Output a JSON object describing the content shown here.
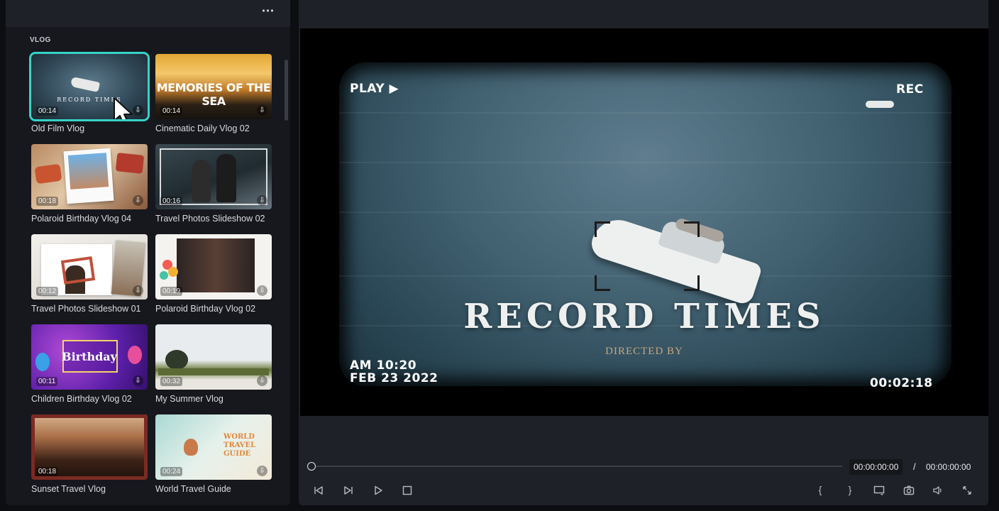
{
  "library": {
    "more_label": "⋯",
    "section_title": "VLOG",
    "templates": [
      {
        "label": "Old Film Vlog",
        "duration": "00:14",
        "caption": "RECORD TIMES"
      },
      {
        "label": "Cinematic Daily Vlog 02",
        "duration": "00:14",
        "caption": "MEMORIES OF THE SEA"
      },
      {
        "label": "Polaroid Birthday Vlog 04",
        "duration": "00:18"
      },
      {
        "label": "Travel Photos Slideshow 02",
        "duration": "00:16"
      },
      {
        "label": "Travel Photos Slideshow 01",
        "duration": "00:12"
      },
      {
        "label": "Polaroid Birthday Vlog 02",
        "duration": "00:19"
      },
      {
        "label": "Children Birthday Vlog 02",
        "duration": "00:11",
        "caption": "Birthday"
      },
      {
        "label": "My Summer Vlog",
        "duration": "00:32"
      },
      {
        "label": "Sunset Travel Vlog",
        "duration": "00:18"
      },
      {
        "label": "World Travel Guide",
        "duration": "00:24",
        "caption": "WORLD TRAVEL GUIDE"
      }
    ]
  },
  "preview": {
    "play_text": "PLAY ▶",
    "rec_text": "REC",
    "clock_line1": "AM 10:20",
    "clock_line2": "FEB 23 2022",
    "timecode_overlay": "00:02:18",
    "title_text": "RECORD TIMES",
    "subtitle_text": "DIRECTED BY"
  },
  "playback": {
    "current_time": "00:00:00:00",
    "separator": "/",
    "total_time": "00:00:00:00",
    "progress": 0
  },
  "controls": {
    "open_brace": "{",
    "close_brace": "}"
  },
  "colors": {
    "selection_outline": "#35d3c8",
    "panel_bg": "#16181d",
    "player_bg": "#1e2127"
  }
}
